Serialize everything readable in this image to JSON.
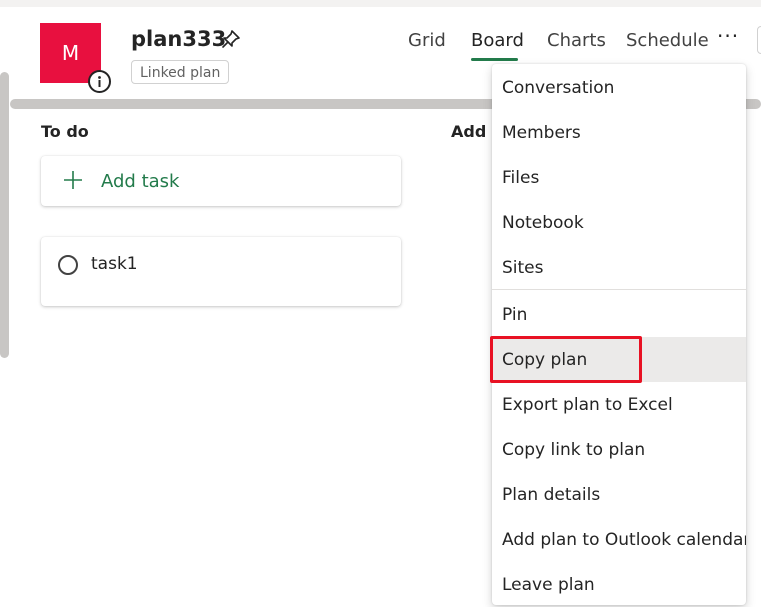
{
  "plan": {
    "avatar_letter": "M",
    "avatar_color": "#e8103f",
    "name": "plan333",
    "badge": "Linked plan",
    "pin_icon": "pin-icon",
    "info_icon": "info-icon"
  },
  "nav": {
    "tabs": [
      {
        "label": "Grid"
      },
      {
        "label": "Board",
        "active": true
      },
      {
        "label": "Charts"
      },
      {
        "label": "Schedule"
      }
    ],
    "more_label": "···",
    "accent_color": "#237b4b"
  },
  "board": {
    "columns": [
      {
        "name": "To do"
      },
      {
        "name": "Add n"
      }
    ],
    "add_task_label": "Add task",
    "tasks": [
      {
        "title": "task1",
        "completed": false
      }
    ]
  },
  "menu": {
    "items": [
      {
        "label": "Conversation"
      },
      {
        "label": "Members"
      },
      {
        "label": "Files"
      },
      {
        "label": "Notebook"
      },
      {
        "label": "Sites"
      },
      {
        "label": "Pin"
      },
      {
        "label": "Copy plan",
        "hovered": true,
        "highlighted": true
      },
      {
        "label": "Export plan to Excel"
      },
      {
        "label": "Copy link to plan"
      },
      {
        "label": "Plan details"
      },
      {
        "label": "Add plan to Outlook calendar"
      },
      {
        "label": "Leave plan"
      }
    ],
    "highlight_color": "#e81123"
  }
}
